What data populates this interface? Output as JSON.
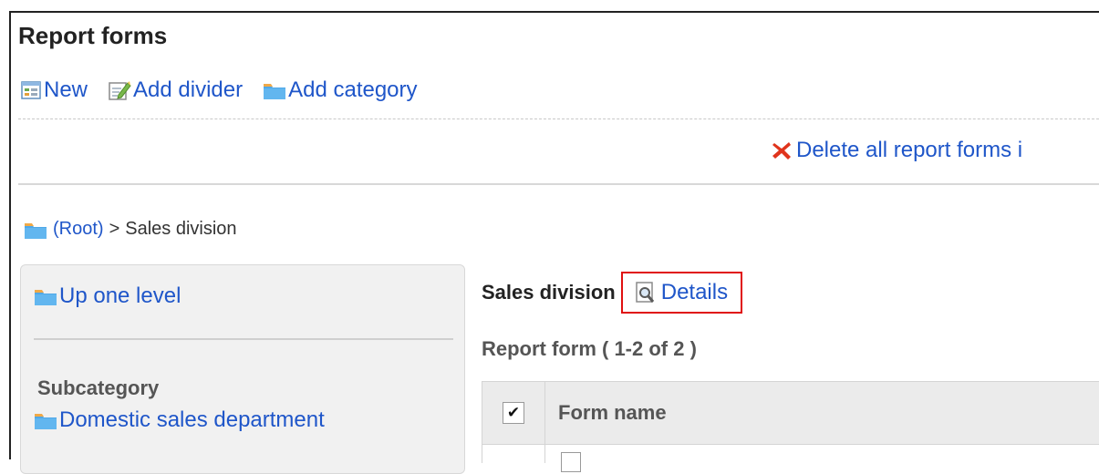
{
  "page": {
    "title": "Report forms"
  },
  "toolbar": {
    "new_label": "New",
    "add_divider_label": "Add divider",
    "add_category_label": "Add category",
    "delete_all_label": "Delete all report forms i"
  },
  "breadcrumb": {
    "root_label": "(Root)",
    "separator": ">",
    "current": "Sales division"
  },
  "sidebar": {
    "up_level_label": "Up one level",
    "subcategory_heading": "Subcategory",
    "subcategories": [
      {
        "label": "Domestic sales department"
      }
    ]
  },
  "main": {
    "category_name": "Sales division",
    "details_label": "Details",
    "count_text": "Report form ( 1-2 of 2 )",
    "table": {
      "columns": [
        "Form name"
      ],
      "header_check_glyph": "✔"
    }
  },
  "colors": {
    "link": "#1f56c9",
    "highlight_box": "#e01010",
    "delete_icon": "#e0341c",
    "folder": "#4fa8e8"
  }
}
